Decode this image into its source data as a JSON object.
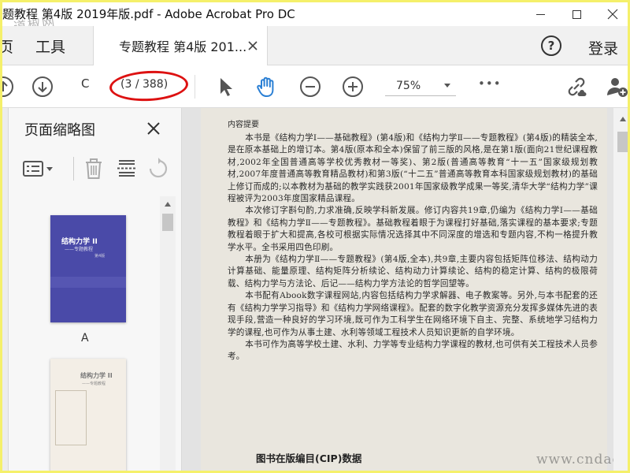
{
  "window": {
    "title": "题教程 第4版 2019年版.pdf - Adobe Acrobat Pro DC",
    "watermark_top": "道椒网"
  },
  "tabs": {
    "home_partial": "页",
    "tools": "工具",
    "document": "专题教程 第4版 201...",
    "help": "?",
    "login": "登录"
  },
  "toolbar": {
    "page_current": "C",
    "page_indicator": "(3 / 388)",
    "zoom": "75%",
    "more": "•••"
  },
  "sidepanel": {
    "title": "页面缩略图",
    "thumbnails": [
      {
        "label": "A",
        "cover_title": "结构力学 II",
        "cover_subtitle": "——专题教程",
        "cover_edition": "第4版"
      },
      {
        "label": "",
        "cover_title": "结构力学 II",
        "cover_subtitle": "——专题教程"
      }
    ]
  },
  "document": {
    "heading": "内容提要",
    "paragraphs": [
      "本书是《结构力学Ⅰ——基础教程》(第4版)和《结构力学Ⅱ——专题教程》(第4版)的精装全本,是在原本基础上的增订本。第4版(原本和全本)保留了前三版的风格,是在第1版(面向21世纪课程教材,2002年全国普通高等学校优秀教材一等奖)、第2版(普通高等教育“十一五”国家级规划教材,2007年度普通高等教育精品教材)和第3版(“十二五”普通高等教育本科国家级规划教材)的基础上修订而成的;以本教材为基础的教学实践获2001年国家级教学成果一等奖,清华大学“结构力学”课程被评为2003年度国家精品课程。",
      "本次修订字斟句酌,力求准确,反映学科新发展。修订内容共19章,仍编为《结构力学Ⅰ——基础教程》和《结构力学Ⅱ——专题教程》。基础教程着眼于为课程打好基础,落实课程的基本要求;专题教程着眼于扩大和提高,各校可根据实际情况选择其中不同深度的增选和专题内容,不构一格提升教学水平。全书采用四色印刷。",
      "本册为《结构力学Ⅱ——专题教程》(第4版,全本),共9章,主要内容包括矩阵位移法、结构动力计算基础、能量原理、结构矩阵分析续论、结构动力计算续论、结构的稳定计算、结构的极限荷载、结构力学与方法论、后记——结构力学方法论的哲学回望等。",
      "本书配有Abook数字课程网站,内容包括结构力学求解器、电子教案等。另外,与本书配套的还有《结构力学学习指导》和《结构力学网络课程》。配套的数字化教学资源充分发挥多媒体先进的表现手段,营造一种良好的学习环境,既可作为工科学生在网络环境下自主、完整、系统地学习结构力学的课程,也可作为从事土建、水利等领域工程技术人员知识更新的自学环境。",
      "本书可作为高等学校土建、水利、力学等专业结构力学课程的教材,也可供有关工程技术人员参考。"
    ],
    "cip_heading": "图书在版编目(CIP)数据",
    "watermark_bottom": "www.cndao.com"
  },
  "colors": {
    "annotation_oval": "#dd1111",
    "cover_blue": "#4a4aa8",
    "hand_tool_blue": "#2a7fd4",
    "frame_yellow": "#f5f06a"
  }
}
